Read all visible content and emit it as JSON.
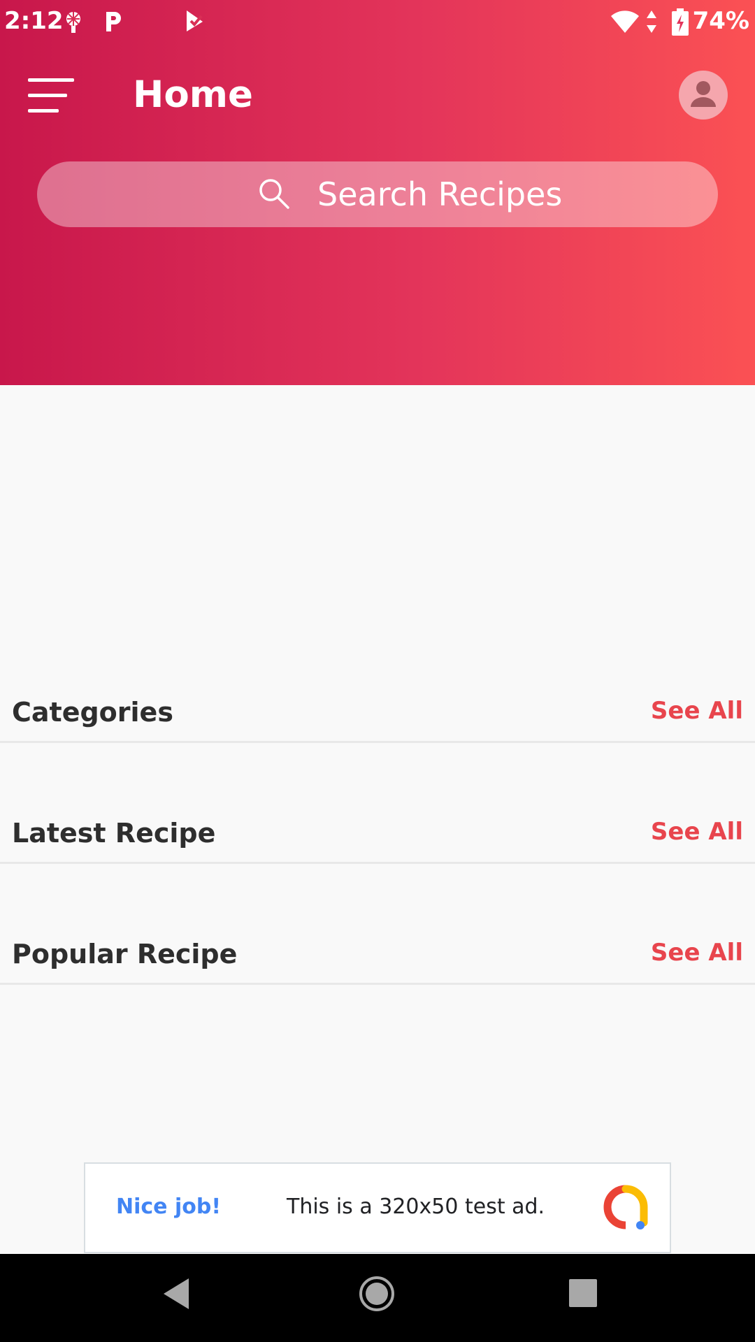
{
  "status_bar": {
    "time": "2:12",
    "battery": "74%",
    "icons": [
      "notification-app-icon",
      "p-app-icon",
      "checkmark-app-icon",
      "wifi-icon",
      "data-arrows-icon",
      "battery-charging-icon"
    ]
  },
  "app_bar": {
    "title": "Home",
    "menu_icon": "menu-icon",
    "avatar_icon": "user-avatar-icon"
  },
  "search": {
    "placeholder": "Search Recipes",
    "icon": "search-icon"
  },
  "sections": [
    {
      "title": "Categories",
      "action": "See All"
    },
    {
      "title": "Latest Recipe",
      "action": "See All"
    },
    {
      "title": "Popular Recipe",
      "action": "See All"
    }
  ],
  "ad_banner": {
    "label": "Nice job!",
    "text": "This is a 320x50 test ad."
  },
  "colors": {
    "header_gradient_start": "#c8174b",
    "header_gradient_end": "#fb5154",
    "accent": "#e8454d",
    "ad_label": "#4285f4"
  },
  "nav_bar": {
    "icons": [
      "back-icon",
      "home-icon",
      "recents-icon"
    ]
  }
}
